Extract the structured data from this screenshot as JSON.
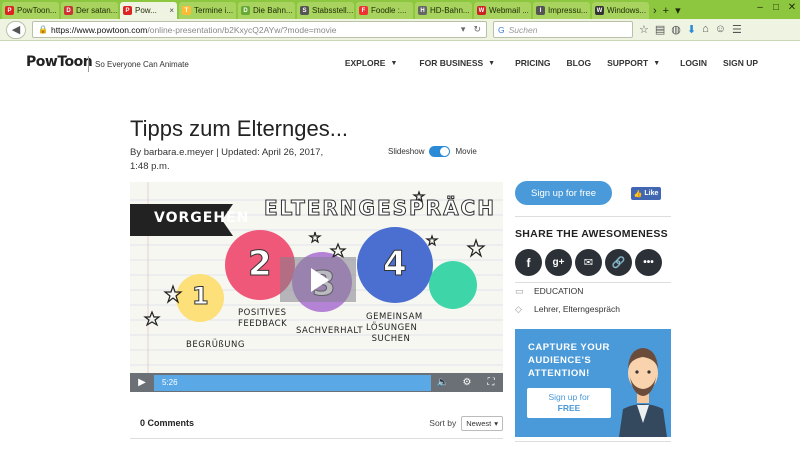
{
  "browser": {
    "tabs": [
      {
        "label": "PowToon...",
        "color": "#d22",
        "glyph": "P",
        "active": false
      },
      {
        "label": "Der satan...",
        "color": "#c33",
        "glyph": "D",
        "active": false
      },
      {
        "label": "Pow...",
        "color": "#d22",
        "glyph": "P",
        "active": true
      },
      {
        "label": "Termine i...",
        "color": "#fb3",
        "glyph": "T",
        "active": false
      },
      {
        "label": "Die Bahn...",
        "color": "#6a3",
        "glyph": "D",
        "active": false
      },
      {
        "label": "Stabsstell...",
        "color": "#555",
        "glyph": "S",
        "active": false
      },
      {
        "label": "Foodle :...",
        "color": "#e33",
        "glyph": "F",
        "active": false
      },
      {
        "label": "HD-Bahn...",
        "color": "#666",
        "glyph": "H",
        "active": false
      },
      {
        "label": "Webmail ...",
        "color": "#c22",
        "glyph": "W",
        "active": false
      },
      {
        "label": "Impressu...",
        "color": "#555",
        "glyph": "I",
        "active": false
      },
      {
        "label": "Windows...",
        "color": "#333",
        "glyph": "W",
        "active": false
      }
    ],
    "url_host": "https://www.powtoon.com",
    "url_path": "/online-presentation/b2KxycQ2AYw/?mode=movie",
    "search_placeholder": "Suchen"
  },
  "header": {
    "logo": "PowToon",
    "tagline": "So Everyone Can Animate",
    "nav": [
      {
        "label": "EXPLORE",
        "dropdown": true
      },
      {
        "label": "FOR BUSINESS",
        "dropdown": true
      },
      {
        "label": "PRICING",
        "dropdown": false
      },
      {
        "label": "BLOG",
        "dropdown": false
      },
      {
        "label": "SUPPORT",
        "dropdown": true
      },
      {
        "label": "LOGIN",
        "dropdown": false
      },
      {
        "label": "SIGN UP",
        "dropdown": false
      }
    ]
  },
  "presentation": {
    "title": "Tipps zum Elternges...",
    "meta_line1": "By barbara.e.meyer  |  Updated: April 26, 2017,",
    "meta_line2": "1:48 p.m.",
    "toggle_left": "Slideshow",
    "toggle_right": "Movie",
    "toggle_state": "Movie"
  },
  "video": {
    "banner": "VORGEHEN",
    "heading": "ELTERNGESPRÄCH",
    "steps": [
      {
        "num": "1",
        "label": "BEGRÜßUNG",
        "color": "#fde07a"
      },
      {
        "num": "2",
        "label": "POSITIVES FEEDBACK",
        "color": "#f0587a"
      },
      {
        "num": "3",
        "label": "SACHVERHALT",
        "color": "#b583d6"
      },
      {
        "num": "4",
        "label": "GEMEINSAM LÖSUNGEN SUCHEN",
        "color": "#4a6fd0"
      },
      {
        "num": "",
        "label": "",
        "color": "#3ed6a8"
      }
    ],
    "time": "5:26",
    "progress": 0.0
  },
  "comments": {
    "count_label": "0 Comments",
    "sort_label": "Sort by",
    "sort_value": "Newest"
  },
  "sidebar": {
    "signup_label": "Sign up for free",
    "like_label": "Like",
    "share_title": "SHARE THE AWESOMENESS",
    "social_icons": [
      "facebook-icon",
      "google-plus-icon",
      "email-icon",
      "link-icon",
      "more-icon"
    ],
    "category": "EDUCATION",
    "tags": "Lehrer, Elterngespräch",
    "promo_text_lines": [
      "CAPTURE YOUR",
      "AUDIENCE'S",
      "ATTENTION!"
    ],
    "promo_button_line1": "Sign up for",
    "promo_button_line2": "FREE"
  },
  "colors": {
    "browser_green": "#8dc63f",
    "accent_blue": "#4a9ad9",
    "dark_icon": "#2c3138"
  }
}
